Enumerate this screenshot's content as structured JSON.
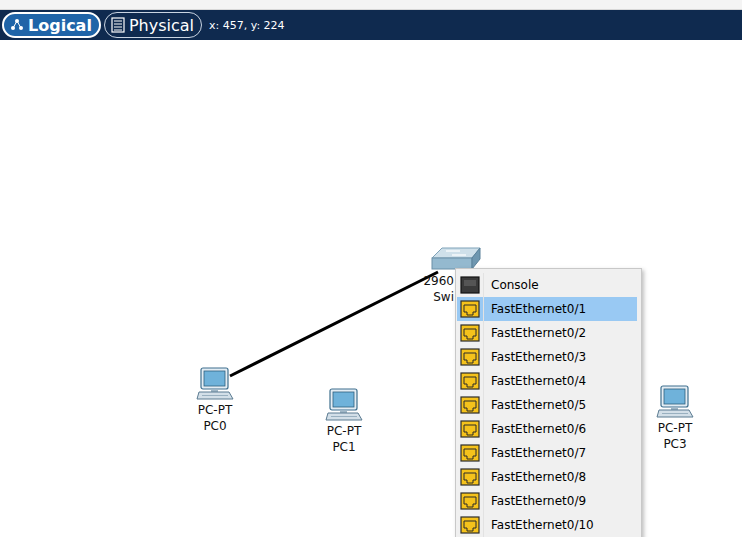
{
  "toolbar": {
    "tabs": [
      {
        "label": "Logical",
        "selected": true,
        "kind": "logical"
      },
      {
        "label": "Physical",
        "selected": false,
        "kind": "physical"
      }
    ],
    "coordinates": "x: 457, y: 224"
  },
  "devices": [
    {
      "model": "2960",
      "name": "Swi",
      "kind": "switch"
    },
    {
      "model": "PC-PT",
      "name": "PC0",
      "kind": "pc"
    },
    {
      "model": "PC-PT",
      "name": "PC1",
      "kind": "pc"
    },
    {
      "model": "PC-PT",
      "name": "PC3",
      "kind": "pc"
    }
  ],
  "links": [
    {
      "from": "PC0",
      "to": "Swi"
    }
  ],
  "port_menu": {
    "items": [
      {
        "label": "Console",
        "kind": "console",
        "selected": false
      },
      {
        "label": "FastEthernet0/1",
        "kind": "ethernet",
        "selected": true
      },
      {
        "label": "FastEthernet0/2",
        "kind": "ethernet",
        "selected": false
      },
      {
        "label": "FastEthernet0/3",
        "kind": "ethernet",
        "selected": false
      },
      {
        "label": "FastEthernet0/4",
        "kind": "ethernet",
        "selected": false
      },
      {
        "label": "FastEthernet0/5",
        "kind": "ethernet",
        "selected": false
      },
      {
        "label": "FastEthernet0/6",
        "kind": "ethernet",
        "selected": false
      },
      {
        "label": "FastEthernet0/7",
        "kind": "ethernet",
        "selected": false
      },
      {
        "label": "FastEthernet0/8",
        "kind": "ethernet",
        "selected": false
      },
      {
        "label": "FastEthernet0/9",
        "kind": "ethernet",
        "selected": false
      },
      {
        "label": "FastEthernet0/10",
        "kind": "ethernet",
        "selected": false
      }
    ]
  }
}
